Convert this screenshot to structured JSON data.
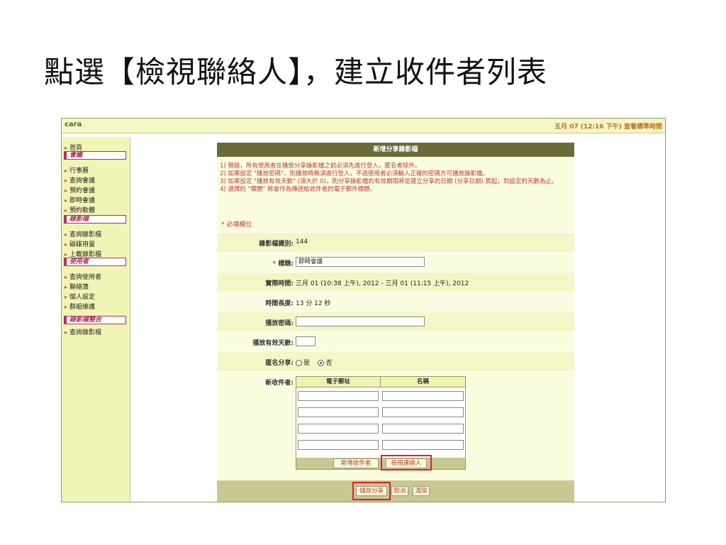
{
  "slide": {
    "title": "點選【檢視聯絡人】，建立收件者列表"
  },
  "topbar": {
    "user": "cara",
    "clock": "五月 07 (12:16 下午) 查看標準時間"
  },
  "sidebar": {
    "items": [
      {
        "type": "link",
        "label": "首頁"
      },
      {
        "type": "head",
        "label": "會議"
      },
      {
        "type": "link",
        "label": "行事曆"
      },
      {
        "type": "link",
        "label": "查詢會議"
      },
      {
        "type": "link",
        "label": "預約會議"
      },
      {
        "type": "link",
        "label": "即時會議"
      },
      {
        "type": "link",
        "label": "預約軟體"
      },
      {
        "type": "head",
        "label": "錄影檔"
      },
      {
        "type": "link",
        "label": "查詢錄影檔"
      },
      {
        "type": "link",
        "label": "磁碟用量"
      },
      {
        "type": "link",
        "label": "上載錄影檔"
      },
      {
        "type": "head",
        "label": "使用者"
      },
      {
        "type": "link",
        "label": "查詢使用者"
      },
      {
        "type": "link",
        "label": "聯絡簿"
      },
      {
        "type": "link",
        "label": "個人設定"
      },
      {
        "type": "link",
        "label": "群組維護"
      },
      {
        "type": "head",
        "label": "錄影檔整合"
      },
      {
        "type": "link",
        "label": "查詢錄影檔"
      }
    ]
  },
  "panel": {
    "header": "新增分享錄影檔",
    "notes": [
      "1) 預設，所有使用者在播放分享錄影檔之前必須先進行登入，匿名者除外。",
      "2) 如果設定 \"播放密碼\"，則播放時無須進行登入，不過使用者必須輸入正確的密碼方可播放錄影檔。",
      "3) 如果設定 \"播放有效天數\" (須大於 0)，則分享錄影檔的有效期限將從建立分享的日期 (分享日期) 算起，到設定的天數為止。",
      "4) 選擇的 \"標題\" 將會作為傳送給收件者的電子郵件標題。"
    ],
    "required_note": "* 必填欄位",
    "fields": {
      "recording_id": {
        "label": "錄影檔識別:",
        "value": "144"
      },
      "title": {
        "label": "標題:",
        "value": "即時會議"
      },
      "actual_time": {
        "label": "實際時間:",
        "value": "三月 01 (10:38 上午), 2012 - 三月 01 (11:15 上午), 2012"
      },
      "duration": {
        "label": "時間長度:",
        "value": "13 分 12 秒"
      },
      "password": {
        "label": "播放密碼:",
        "value": ""
      },
      "valid_days": {
        "label": "播放有效天數:",
        "value": ""
      },
      "anonymous": {
        "label": "匿名分享:",
        "yes": "是",
        "no": "否",
        "selected": "no"
      },
      "recipients": {
        "label": "新收件者:",
        "col_email": "電子郵址",
        "col_name": "名稱"
      }
    },
    "buttons": {
      "add_recipient": "新增收件者",
      "view_contacts": "檢視連絡人",
      "save_share": "儲存分享",
      "cancel": "取消",
      "clear": "清除"
    }
  }
}
